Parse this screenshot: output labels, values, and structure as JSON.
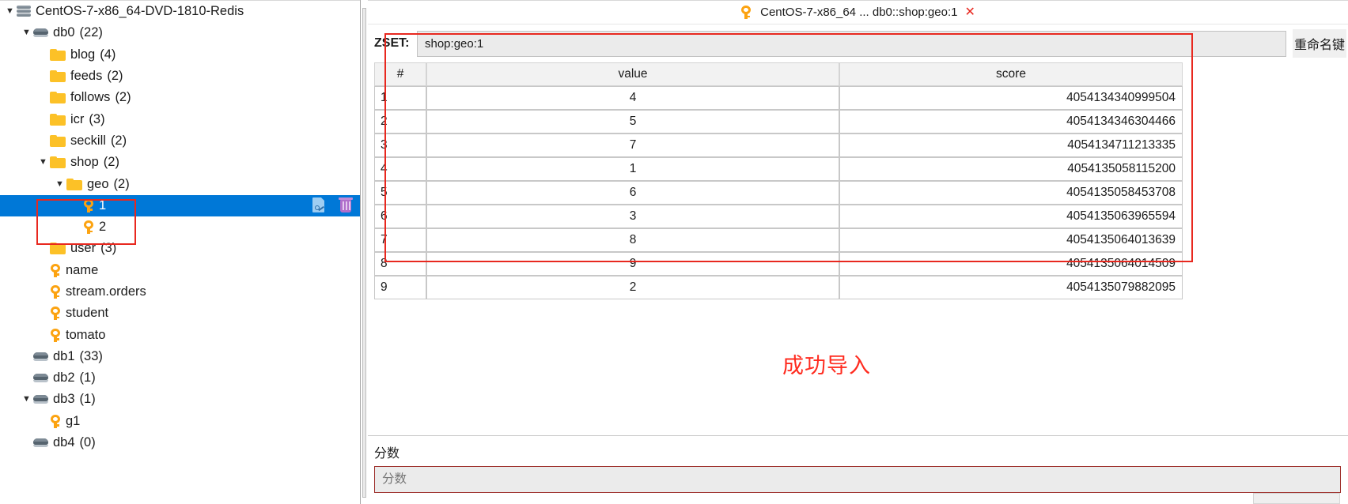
{
  "sidebar": {
    "tree": [
      {
        "depth": 0,
        "twisty": "▼",
        "icon": "server-icon",
        "label": "CentOS-7-x86_64-DVD-1810-Redis",
        "count": ""
      },
      {
        "depth": 1,
        "twisty": "▼",
        "icon": "database-icon",
        "label": "db0",
        "count": "(22)"
      },
      {
        "depth": 2,
        "twisty": "",
        "icon": "folder-icon",
        "label": "blog",
        "count": "(4)"
      },
      {
        "depth": 2,
        "twisty": "",
        "icon": "folder-icon",
        "label": "feeds",
        "count": "(2)"
      },
      {
        "depth": 2,
        "twisty": "",
        "icon": "folder-icon",
        "label": "follows",
        "count": "(2)"
      },
      {
        "depth": 2,
        "twisty": "",
        "icon": "folder-icon",
        "label": "icr",
        "count": "(3)"
      },
      {
        "depth": 2,
        "twisty": "",
        "icon": "folder-icon",
        "label": "seckill",
        "count": "(2)"
      },
      {
        "depth": 2,
        "twisty": "▼",
        "icon": "folder-icon",
        "label": "shop",
        "count": "(2)"
      },
      {
        "depth": 3,
        "twisty": "▼",
        "icon": "folder-icon",
        "label": "geo",
        "count": "(2)"
      },
      {
        "depth": 4,
        "twisty": "",
        "icon": "key-icon",
        "label": "1",
        "count": "",
        "selected": true
      },
      {
        "depth": 4,
        "twisty": "",
        "icon": "key-icon",
        "label": "2",
        "count": ""
      },
      {
        "depth": 2,
        "twisty": "",
        "icon": "folder-icon",
        "label": "user",
        "count": "(3)"
      },
      {
        "depth": 2,
        "twisty": "",
        "icon": "key-icon",
        "label": "name",
        "count": ""
      },
      {
        "depth": 2,
        "twisty": "",
        "icon": "key-icon",
        "label": "stream.orders",
        "count": ""
      },
      {
        "depth": 2,
        "twisty": "",
        "icon": "key-icon",
        "label": "student",
        "count": ""
      },
      {
        "depth": 2,
        "twisty": "",
        "icon": "key-icon",
        "label": "tomato",
        "count": ""
      },
      {
        "depth": 1,
        "twisty": "",
        "icon": "database-icon",
        "label": "db1",
        "count": "(33)"
      },
      {
        "depth": 1,
        "twisty": "",
        "icon": "database-icon",
        "label": "db2",
        "count": "(1)"
      },
      {
        "depth": 1,
        "twisty": "▼",
        "icon": "database-icon",
        "label": "db3",
        "count": "(1)"
      },
      {
        "depth": 2,
        "twisty": "",
        "icon": "key-icon",
        "label": "g1",
        "count": ""
      },
      {
        "depth": 1,
        "twisty": "",
        "icon": "database-icon",
        "label": "db4",
        "count": "(0)"
      }
    ],
    "row_actions": {
      "edit_title": "edit-key",
      "delete_title": "delete-key"
    }
  },
  "main": {
    "tab": {
      "title": "CentOS-7-x86_64 ... db0::shop:geo:1",
      "close_label": "✕"
    },
    "key_editor": {
      "type_label": "ZSET:",
      "key_value": "shop:geo:1",
      "rename_button": "重命名键"
    },
    "table": {
      "headers": [
        "#",
        "value",
        "score"
      ],
      "rows": [
        {
          "idx": "1",
          "value": "4",
          "score": "4054134340999504"
        },
        {
          "idx": "2",
          "value": "5",
          "score": "4054134346304466"
        },
        {
          "idx": "3",
          "value": "7",
          "score": "4054134711213335"
        },
        {
          "idx": "4",
          "value": "1",
          "score": "4054135058115200"
        },
        {
          "idx": "5",
          "value": "6",
          "score": "4054135058453708"
        },
        {
          "idx": "6",
          "value": "3",
          "score": "4054135063965594"
        },
        {
          "idx": "7",
          "value": "8",
          "score": "4054135064013639"
        },
        {
          "idx": "8",
          "value": "9",
          "score": "4054135064014509"
        },
        {
          "idx": "9",
          "value": "2",
          "score": "4054135079882095"
        }
      ]
    },
    "success_message": "成功导入",
    "bottom": {
      "score_label": "分数",
      "score_placeholder": "分数",
      "score_value": ""
    }
  },
  "colors": {
    "selection_blue": "#0078d7",
    "highlight_red": "#e8281f",
    "success_red": "#ff2b1f",
    "key_orange": "#fca311",
    "folder_yellow": "#fcc127"
  }
}
